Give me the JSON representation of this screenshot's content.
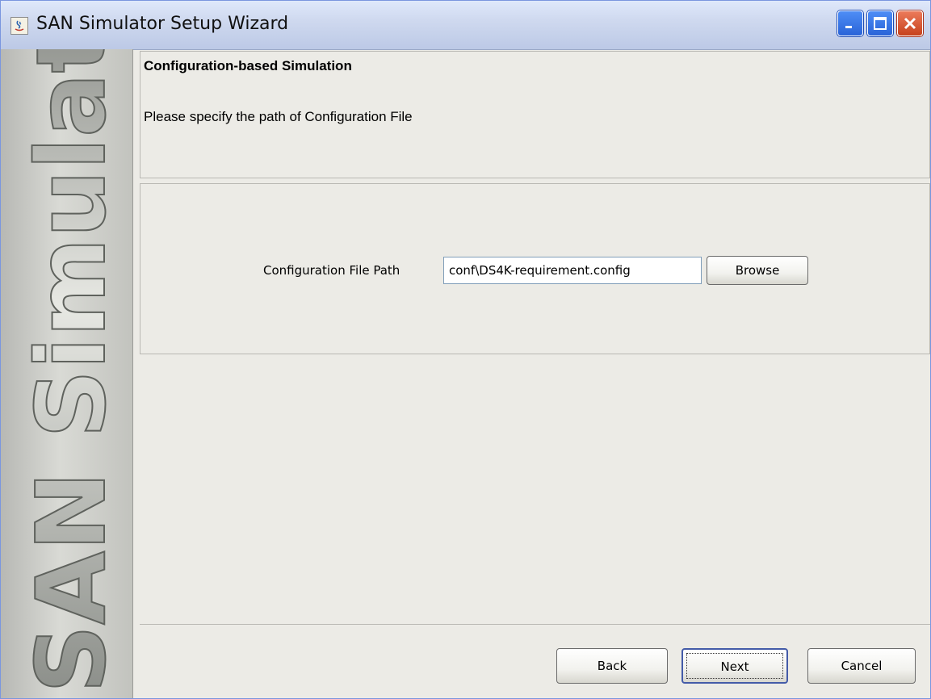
{
  "window": {
    "title": "SAN Simulator Setup Wizard",
    "controls": [
      "minimize",
      "maximize",
      "close"
    ]
  },
  "sidebar": {
    "logo_text": "SAN Simulator"
  },
  "header": {
    "title": "Configuration-based Simulation",
    "description": "Please specify the path of Configuration File"
  },
  "form": {
    "path_label": "Configuration File Path",
    "path_value": "conf\\DS4K-requirement.config",
    "browse_label": "Browse"
  },
  "footer": {
    "back_label": "Back",
    "next_label": "Next",
    "cancel_label": "Cancel"
  },
  "colors": {
    "titlebar": "#cfd9ef",
    "close_button": "#d9562f",
    "control_button": "#3a78e6",
    "panel": "#ecebe6"
  }
}
